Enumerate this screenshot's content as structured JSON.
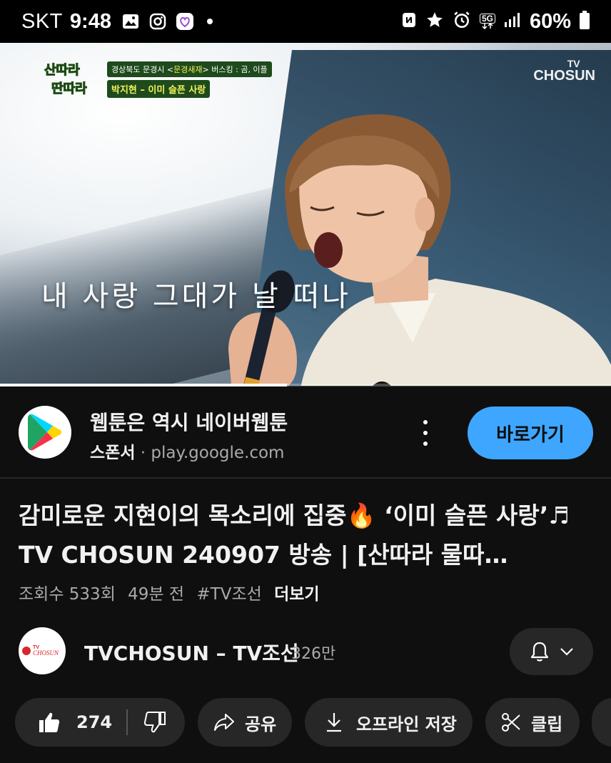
{
  "status_bar": {
    "carrier": "SKT",
    "time": "9:48",
    "network": "5G",
    "battery": "60%"
  },
  "video": {
    "channel_watermark_top": "TV",
    "channel_watermark_bottom": "CHOSUN",
    "caption_location_pre": "경상북도 문경시 <",
    "caption_location_hl": "문경새재",
    "caption_location_post": "> 버스킹 : 곰, 이플",
    "caption_song": "박지현 – 이미 슬픈 사랑",
    "lyric": "내 사랑 그대가 날 떠나",
    "progress": 0.47
  },
  "ad": {
    "title": "웹툰은 역시 네이버웹툰",
    "sponsor_label": "스폰서",
    "dot": " · ",
    "domain": "play.google.com",
    "cta": "바로가기",
    "logo_icon": "google-play-icon"
  },
  "video_info": {
    "title": "감미로운 지현이의 목소리에 집중🔥 ‘이미 슬픈 사랑’♬ TV CHOSUN 240907 방송 | [산따라 물따…",
    "views": "조회수 533회",
    "age": "49분 전",
    "hashtag": "#TV조선",
    "more": "더보기"
  },
  "channel": {
    "name": "TVCHOSUN – TV조선",
    "subscribers": "326만",
    "avatar_top": "TV",
    "avatar_bottom": "CHOSUN"
  },
  "actions": {
    "like_count": "274",
    "share": "공유",
    "download": "오프라인 저장",
    "clip": "클립"
  }
}
